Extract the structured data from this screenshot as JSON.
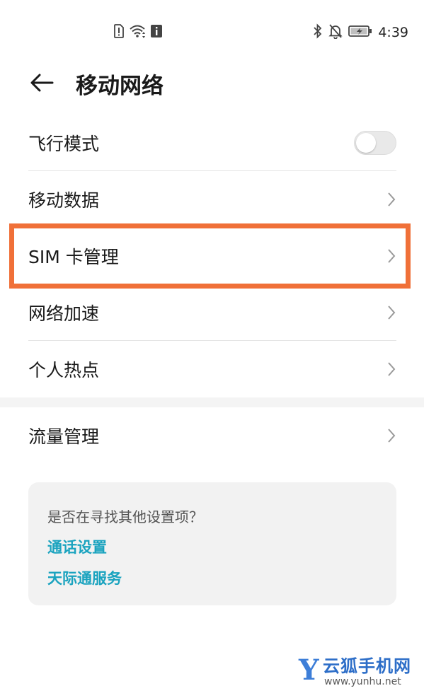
{
  "status_bar": {
    "time": "4:39",
    "left_icons": [
      "sim-alert-icon",
      "wifi-icon",
      "notification-i-icon"
    ],
    "right_icons": [
      "bluetooth-icon",
      "bell-off-icon",
      "battery-icon"
    ]
  },
  "header": {
    "title": "移动网络",
    "back_icon": "arrow-left-icon"
  },
  "settings": {
    "airplane_mode": {
      "label": "飞行模式",
      "enabled": false
    },
    "mobile_data": {
      "label": "移动数据"
    },
    "sim_management": {
      "label": "SIM 卡管理"
    },
    "network_boost": {
      "label": "网络加速"
    },
    "hotspot": {
      "label": "个人热点"
    },
    "data_usage": {
      "label": "流量管理"
    }
  },
  "suggestions": {
    "question": "是否在寻找其他设置项？",
    "links": [
      "通话设置",
      "天际通服务"
    ]
  },
  "colors": {
    "accent_link": "#1aa3bf",
    "highlight_border": "#f07038"
  },
  "watermark": {
    "letter": "Y",
    "name": "云狐手机网",
    "url": "www.yunhu.net"
  }
}
